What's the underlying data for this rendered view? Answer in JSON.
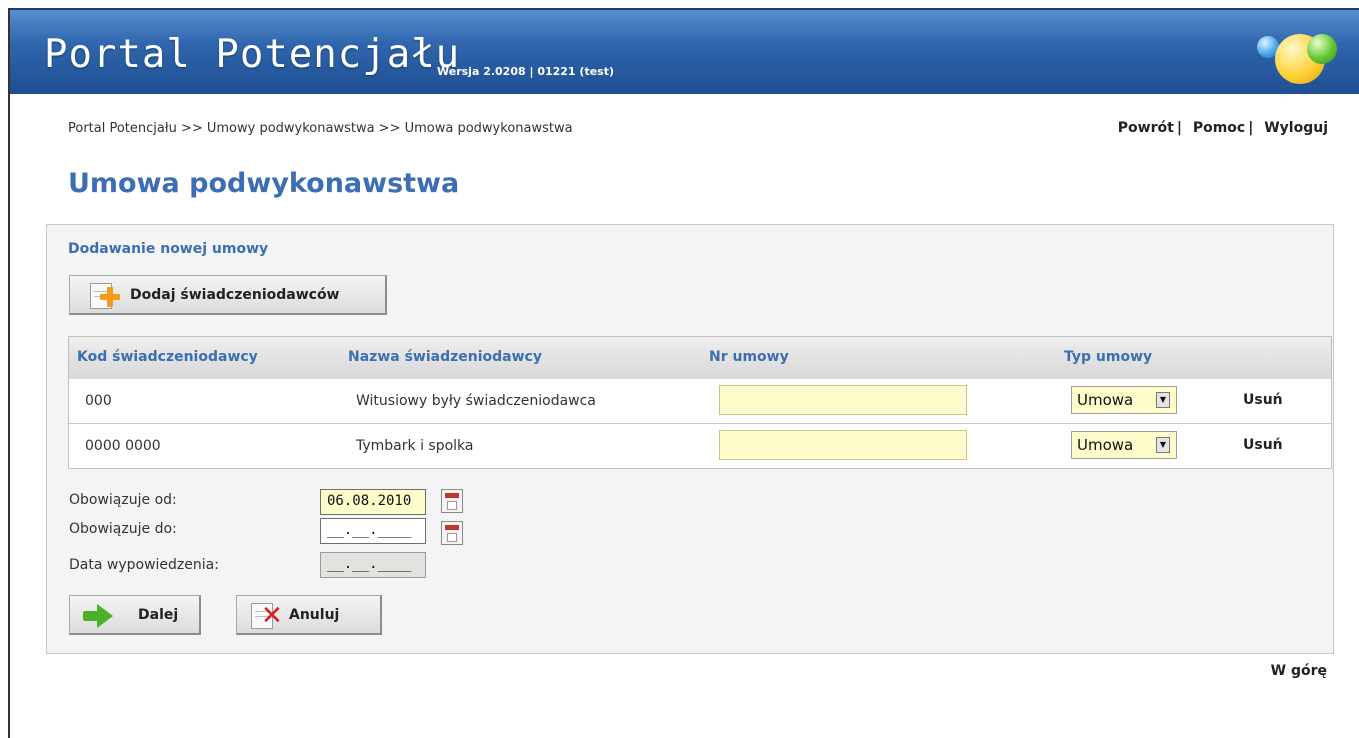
{
  "header": {
    "title": "Portal Potencjału",
    "version": "Wersja 2.0208 | 01221 (test)"
  },
  "breadcrumb": "Portal Potencjału >> Umowy podwykonawstwa >> Umowa podwykonawstwa",
  "toplinks": {
    "back": "Powrót",
    "help": "Pomoc",
    "logout": "Wyloguj",
    "separator": "|"
  },
  "page_title": "Umowa podwykonawstwa",
  "section_title": "Dodawanie nowej umowy",
  "buttons": {
    "add_providers": "Dodaj świadczeniodawców",
    "next": "Dalej",
    "cancel": "Anuluj"
  },
  "table": {
    "columns": [
      "Kod świadczeniodawcy",
      "Nazwa świadzeniodawcy",
      "Nr umowy",
      "Typ umowy"
    ],
    "rows": [
      {
        "code": "000",
        "name": "Witusiowy były świadczeniodawca",
        "contract_no": "",
        "type": "Umowa",
        "action": "Usuń"
      },
      {
        "code": "0000 0000",
        "name": "Tymbark i spolka",
        "contract_no": "",
        "type": "Umowa",
        "action": "Usuń"
      }
    ]
  },
  "form": {
    "valid_from": {
      "label": "Obowiązuje od:",
      "value": "06.08.2010"
    },
    "valid_to": {
      "label": "Obowiązuje do:",
      "value": "__.__.____"
    },
    "termination_date": {
      "label": "Data wypowiedzenia:",
      "value": "__.__.____"
    }
  },
  "footer": {
    "to_top": "W górę"
  },
  "colors": {
    "header_blue": "#2f66ad",
    "title_blue": "#3b6eb4",
    "input_yellow": "#fffccc",
    "panel_bg": "#f4f4f4"
  },
  "icons": {
    "add_button": "document-plus-icon",
    "next_button": "green-arrow-right-icon",
    "cancel_button": "document-red-x-icon",
    "calendar": "calendar-icon",
    "dropdown": "dropdown-arrow-icon"
  }
}
